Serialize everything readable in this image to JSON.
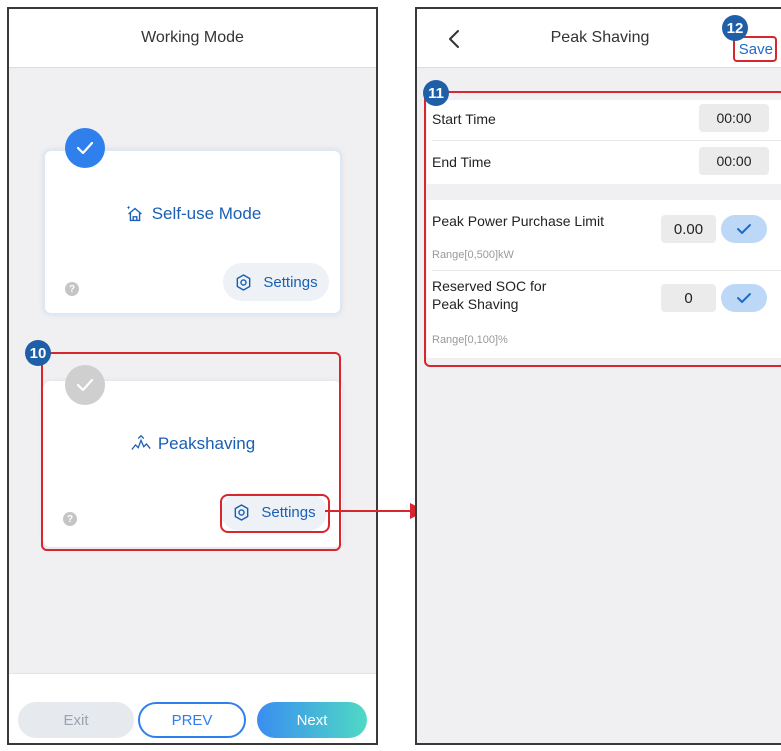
{
  "left_screen": {
    "title": "Working Mode",
    "modes": [
      {
        "name": "Self-use Mode",
        "icon": "house-sparkle-icon",
        "selected": true,
        "settings_label": "Settings",
        "help": "?"
      },
      {
        "name": "Peakshaving",
        "icon": "peak-graph-icon",
        "selected": false,
        "settings_label": "Settings",
        "help": "?"
      }
    ],
    "buttons": {
      "exit": "Exit",
      "prev": "PREV",
      "next": "Next"
    }
  },
  "right_screen": {
    "title": "Peak Shaving",
    "save_label": "Save",
    "start_time": {
      "label": "Start Time",
      "value": "00:00"
    },
    "end_time": {
      "label": "End Time",
      "value": "00:00"
    },
    "peak_power": {
      "label": "Peak Power Purchase Limit",
      "value": "0.00",
      "range": "Range[0,500]kW"
    },
    "reserved_soc": {
      "label_line1": "Reserved SOC for",
      "label_line2": "Peak Shaving",
      "value": "0",
      "range": "Range[0,100]%"
    }
  },
  "callouts": {
    "c10": "10",
    "c11": "11",
    "c12": "12"
  },
  "colors": {
    "accent": "#2f80ed",
    "highlight_red": "#d8262f",
    "badge": "#1f5fa8"
  }
}
